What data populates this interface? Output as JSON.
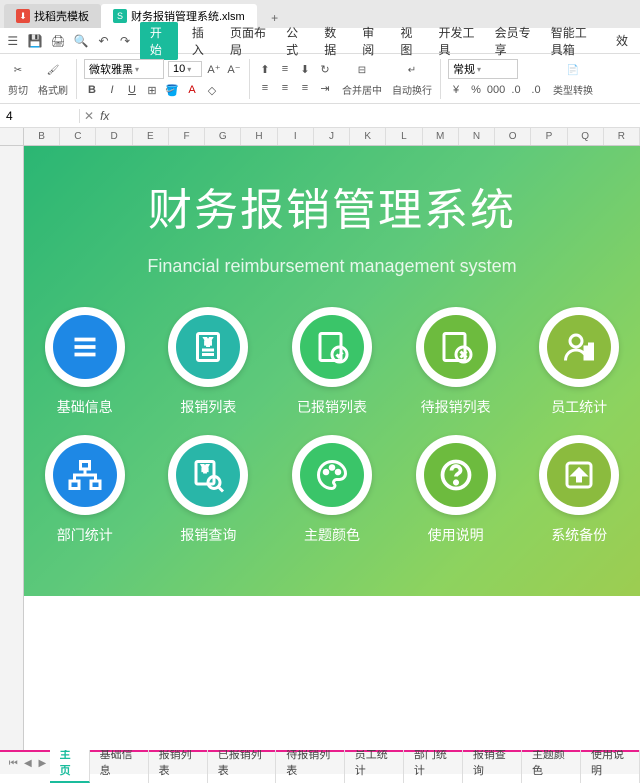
{
  "tabs": {
    "left": "找稻壳模板",
    "active": "财务报销管理系统.xlsm"
  },
  "menu": {
    "start": "开始",
    "items": [
      "插入",
      "页面布局",
      "公式",
      "数据",
      "审阅",
      "视图",
      "开发工具",
      "会员专享",
      "智能工具箱",
      "效"
    ]
  },
  "toolbar": {
    "cut": "剪切",
    "formatPainter": "格式刷",
    "font": "微软雅黑",
    "fontSize": "10",
    "mergeCenter": "合并居中",
    "autoWrap": "自动换行",
    "numFormat": "常规",
    "typeConvert": "类型转换"
  },
  "cellRef": "4",
  "fxLabel": "fx",
  "columns": [
    "B",
    "C",
    "D",
    "E",
    "F",
    "G",
    "H",
    "I",
    "J",
    "K",
    "L",
    "M",
    "N",
    "O",
    "P",
    "Q",
    "R"
  ],
  "canvas": {
    "titleZh": "财务报销管理系统",
    "titleEn": "Financial reimbursement management system",
    "icons": [
      {
        "label": "基础信息",
        "color": "#1e88e5",
        "icon": "list"
      },
      {
        "label": "报销列表",
        "color": "#29b6a8",
        "icon": "doc"
      },
      {
        "label": "已报销列表",
        "color": "#3ac569",
        "icon": "check"
      },
      {
        "label": "待报销列表",
        "color": "#6dbb3e",
        "icon": "cancel"
      },
      {
        "label": "员工统计",
        "color": "#8bbb3e",
        "icon": "person"
      },
      {
        "label": "部门统计",
        "color": "#1e88e5",
        "icon": "org"
      },
      {
        "label": "报销查询",
        "color": "#29b6a8",
        "icon": "search"
      },
      {
        "label": "主题颜色",
        "color": "#3ac569",
        "icon": "palette"
      },
      {
        "label": "使用说明",
        "color": "#6dbb3e",
        "icon": "help"
      },
      {
        "label": "系统备份",
        "color": "#8bbb3e",
        "icon": "backup"
      }
    ]
  },
  "sheetTabs": {
    "active": "主页",
    "tabs": [
      "主页",
      "基础信息",
      "报销列表",
      "已报销列表",
      "待报销列表",
      "员工统计",
      "部门统计",
      "报销查询",
      "主题颜色",
      "使用说明"
    ]
  }
}
